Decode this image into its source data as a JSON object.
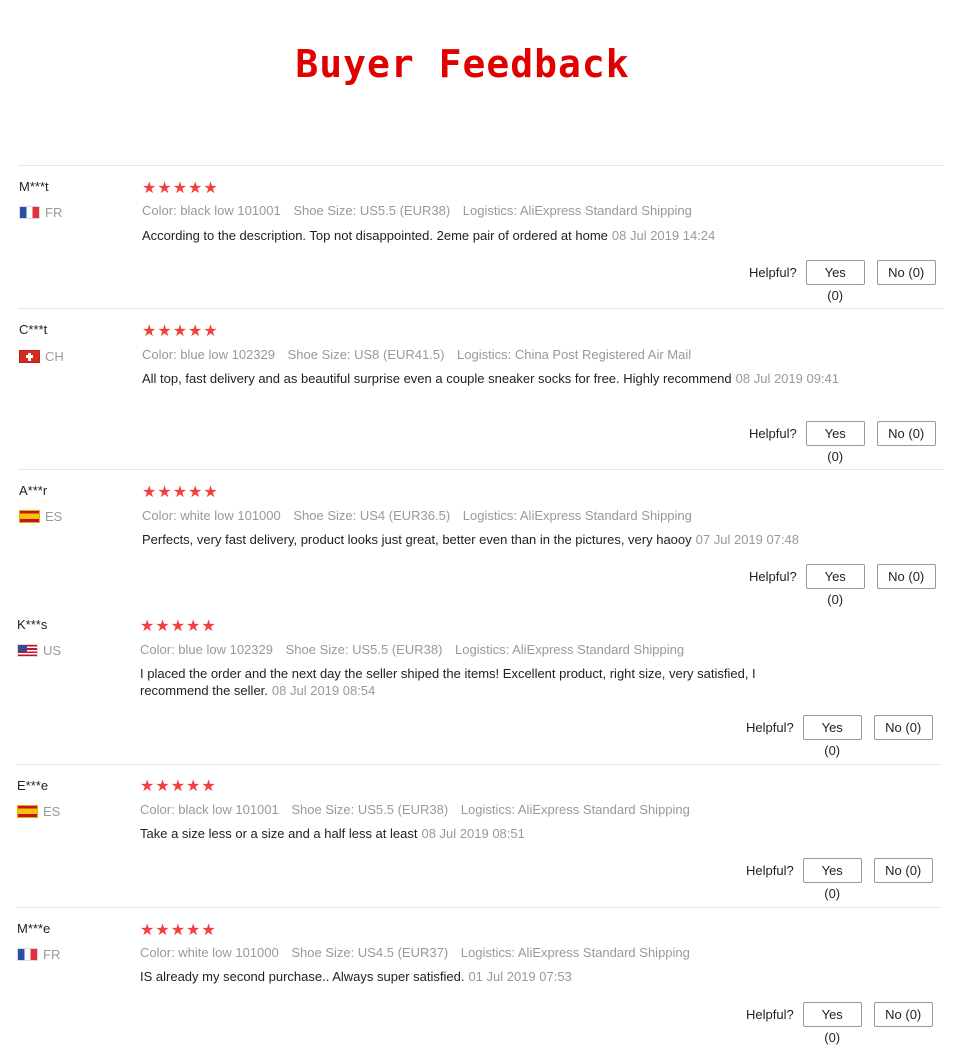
{
  "title": "Buyer Feedback",
  "helpful_label": "Helpful?",
  "stars_text": "★★★★★",
  "reviews": [
    {
      "name": "M***t",
      "country": "FR",
      "color": "Color: black low 101001",
      "size": "Shoe Size: US5.5 (EUR38)",
      "logistics": "Logistics: AliExpress Standard Shipping",
      "text": "According to the description. Top not disappointed. 2eme pair of ordered at home",
      "date": "08 Jul 2019 14:24",
      "yes": "Yes (0)",
      "no": "No (0)"
    },
    {
      "name": "C***t",
      "country": "CH",
      "color": "Color: blue low 102329",
      "size": "Shoe Size: US8 (EUR41.5)",
      "logistics": "Logistics: China Post Registered Air Mail",
      "text": "All top, fast delivery and as beautiful surprise even a couple sneaker socks for free. Highly recommend",
      "date": "08 Jul 2019 09:41",
      "yes": "Yes (0)",
      "no": "No (0)"
    },
    {
      "name": "A***r",
      "country": "ES",
      "color": "Color: white low 101000",
      "size": "Shoe Size: US4 (EUR36.5)",
      "logistics": "Logistics: AliExpress Standard Shipping",
      "text": "Perfects, very fast delivery, product looks just great, better even than in the pictures, very haooy",
      "date": "07 Jul 2019 07:48",
      "yes": "Yes (0)",
      "no": "No (0)"
    },
    {
      "name": "K***s",
      "country": "US",
      "color": "Color: blue low 102329",
      "size": "Shoe Size: US5.5 (EUR38)",
      "logistics": "Logistics: AliExpress Standard Shipping",
      "text": "I placed the order and the next day the seller shiped the items! Excellent product, right size, very satisfied, I recommend the seller.",
      "date": "08 Jul 2019 08:54",
      "yes": "Yes (0)",
      "no": "No (0)"
    },
    {
      "name": "E***e",
      "country": "ES",
      "color": "Color: black low 101001",
      "size": "Shoe Size: US5.5 (EUR38)",
      "logistics": "Logistics: AliExpress Standard Shipping",
      "text": "Take a size less or a size and a half less at least",
      "date": "08 Jul 2019 08:51",
      "yes": "Yes (0)",
      "no": "No (0)"
    },
    {
      "name": "M***e",
      "country": "FR",
      "color": "Color: white low 101000",
      "size": "Shoe Size: US4.5 (EUR37)",
      "logistics": "Logistics: AliExpress Standard Shipping",
      "text": "IS already my second purchase.. Always super satisfied.",
      "date": "01 Jul 2019 07:53",
      "yes": "Yes (0)",
      "no": "No (0)"
    }
  ]
}
